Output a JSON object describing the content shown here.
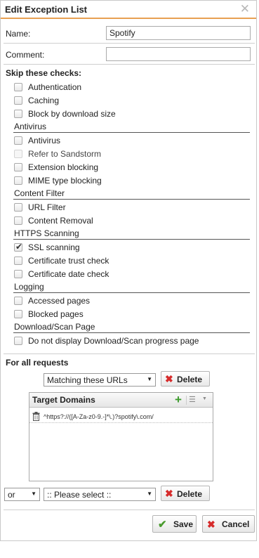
{
  "dialog": {
    "title": "Edit Exception List",
    "close_glyph": "✕"
  },
  "fields": {
    "name_label": "Name:",
    "name_value": "Spotify",
    "comment_label": "Comment:",
    "comment_value": ""
  },
  "skip": {
    "title": "Skip these checks:",
    "general": [
      {
        "label": "Authentication",
        "checked": false
      },
      {
        "label": "Caching",
        "checked": false
      },
      {
        "label": "Block by download size",
        "checked": false
      }
    ],
    "antivirus": {
      "header": "Antivirus",
      "items": [
        {
          "label": "Antivirus",
          "checked": false
        },
        {
          "label": "Refer to Sandstorm",
          "checked": false,
          "disabled": true
        },
        {
          "label": "Extension blocking",
          "checked": false
        },
        {
          "label": "MIME type blocking",
          "checked": false
        }
      ]
    },
    "content_filter": {
      "header": "Content Filter",
      "items": [
        {
          "label": "URL Filter",
          "checked": false
        },
        {
          "label": "Content Removal",
          "checked": false
        }
      ]
    },
    "https": {
      "header": "HTTPS Scanning",
      "items": [
        {
          "label": "SSL scanning",
          "checked": true
        },
        {
          "label": "Certificate trust check",
          "checked": false
        },
        {
          "label": "Certificate date check",
          "checked": false
        }
      ]
    },
    "logging": {
      "header": "Logging",
      "items": [
        {
          "label": "Accessed pages",
          "checked": false
        },
        {
          "label": "Blocked pages",
          "checked": false
        }
      ]
    },
    "download": {
      "header": "Download/Scan Page",
      "items": [
        {
          "label": "Do not display Download/Scan progress page",
          "checked": false
        }
      ]
    }
  },
  "requests": {
    "title": "For all requests",
    "matching_select": "Matching these URLs",
    "delete_label": "Delete",
    "panel_title": "Target Domains",
    "domains": [
      "^https?://([A-Za-z0-9.-]*\\.)?spotify\\.com/"
    ],
    "operator_select": "or",
    "please_select": ":: Please select ::"
  },
  "footer": {
    "save_label": "Save",
    "cancel_label": "Cancel"
  },
  "colors": {
    "accent": "#e8a052",
    "save_icon": "#4a9b2e",
    "delete_icon": "#d62b2b",
    "add_icon": "#3c9b2c"
  }
}
